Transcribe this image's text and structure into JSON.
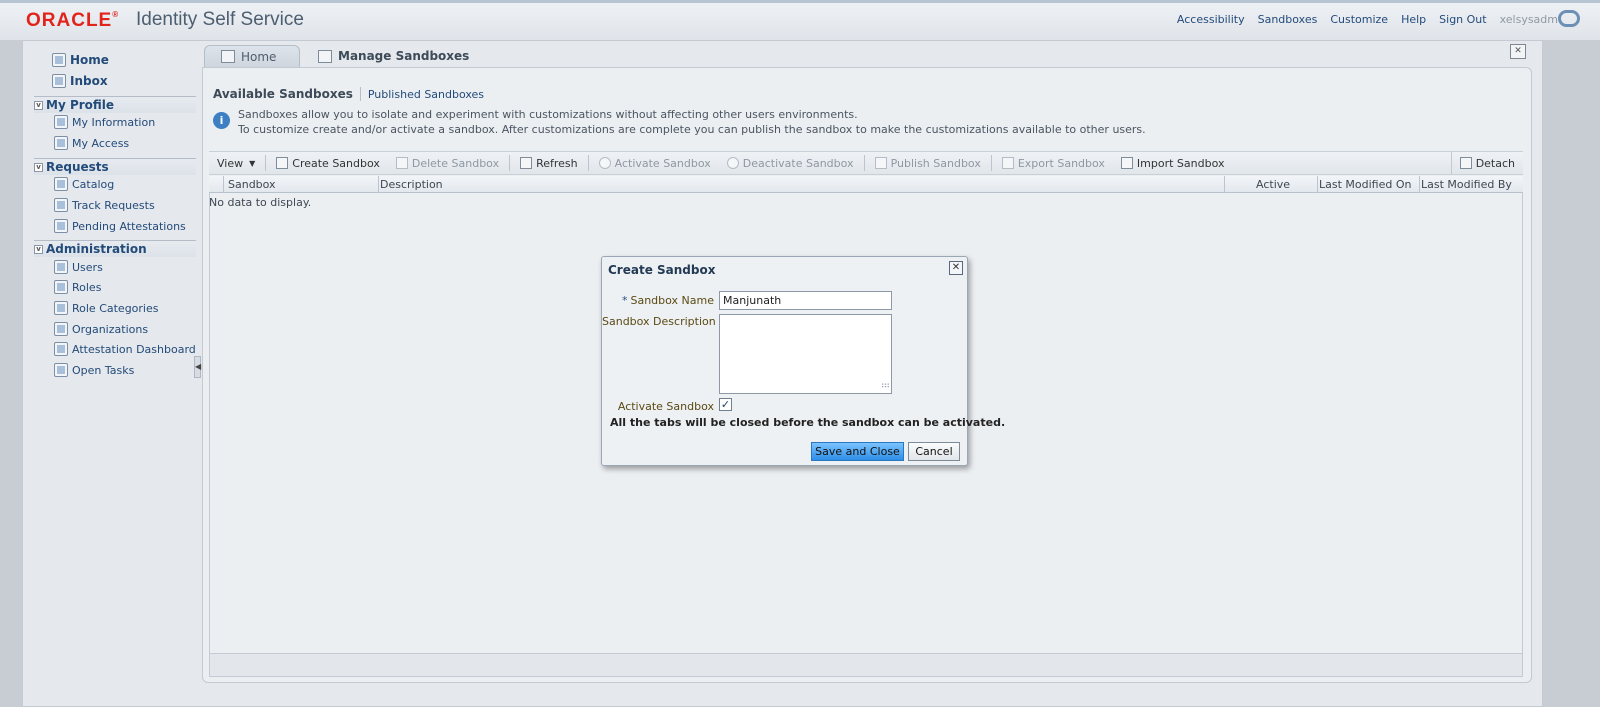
{
  "header": {
    "logo": "ORACLE",
    "logo_mark": "®",
    "title": "Identity Self Service",
    "links": [
      "Accessibility",
      "Sandboxes",
      "Customize",
      "Help",
      "Sign Out"
    ],
    "username": "xelsysadm"
  },
  "nav": {
    "home": "Home",
    "inbox": "Inbox",
    "my_profile": {
      "title": "My Profile",
      "items": [
        "My Information",
        "My Access"
      ]
    },
    "requests": {
      "title": "Requests",
      "items": [
        "Catalog",
        "Track Requests",
        "Pending Attestations"
      ]
    },
    "administration": {
      "title": "Administration",
      "items": [
        "Users",
        "Roles",
        "Role Categories",
        "Organizations",
        "Attestation Dashboard",
        "Open Tasks"
      ]
    }
  },
  "tabs": [
    "Home",
    "Manage Sandboxes"
  ],
  "subtabs": {
    "active": "Available Sandboxes",
    "other": "Published Sandboxes"
  },
  "info": {
    "line1": "Sandboxes allow you to isolate and experiment with customizations without affecting other users environments.",
    "line2": "To customize create and/or activate a sandbox. After customizations are complete you can publish the sandbox to make the customizations available to other users."
  },
  "toolbar": {
    "view": "View",
    "create": "Create Sandbox",
    "delete": "Delete Sandbox",
    "refresh": "Refresh",
    "activate": "Activate Sandbox",
    "deactivate": "Deactivate Sandbox",
    "publish": "Publish Sandbox",
    "export": "Export Sandbox",
    "import": "Import Sandbox",
    "detach": "Detach"
  },
  "table": {
    "columns": [
      "Sandbox",
      "Description",
      "Active",
      "Last Modified On",
      "Last Modified By"
    ],
    "empty_message": "No data to display."
  },
  "dialog": {
    "title": "Create Sandbox",
    "name_label": "Sandbox Name",
    "name_value": "Manjunath",
    "description_label": "Sandbox Description",
    "description_value": "",
    "activate_label": "Activate Sandbox",
    "activate_checked": true,
    "activate_mark": "✓",
    "warning": "All the tabs will be closed before the sandbox can be activated.",
    "save_label": "Save and Close",
    "cancel_label": "Cancel"
  }
}
